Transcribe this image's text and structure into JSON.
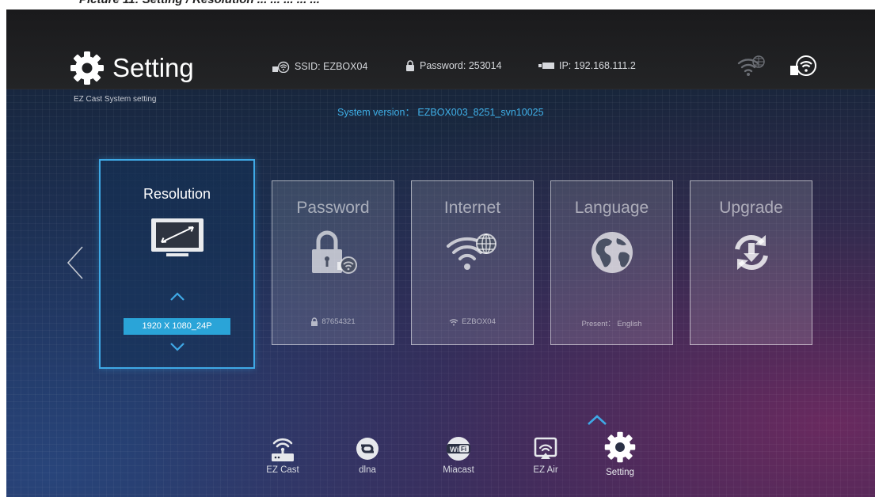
{
  "caption": "Picture 11: Setting / Resolution ... ... ... ... ...",
  "header": {
    "title": "Setting",
    "subtitle": "EZ Cast System setting",
    "ssid": "SSID: EZBOX04",
    "password": "Password: 253014",
    "ip": "IP: 192.168.111.2",
    "system_version": "System version： EZBOX003_8251_svn10025"
  },
  "cards": {
    "resolution": {
      "label": "Resolution",
      "value": "1920 X 1080_24P"
    },
    "password": {
      "label": "Password",
      "footer": "87654321"
    },
    "internet": {
      "label": "Internet",
      "footer": "EZBOX04"
    },
    "language": {
      "label": "Language",
      "footer": "Present： English"
    },
    "upgrade": {
      "label": "Upgrade"
    }
  },
  "bottom_nav": {
    "items": [
      {
        "label": "EZ Cast",
        "icon": "router-icon"
      },
      {
        "label": "dlna",
        "icon": "dlna-icon"
      },
      {
        "label": "Miacast",
        "icon": "wifi-badge-icon"
      },
      {
        "label": "EZ Air",
        "icon": "airplay-icon"
      },
      {
        "label": "Setting",
        "icon": "gear-icon"
      }
    ],
    "active": "Setting"
  },
  "colors": {
    "accent": "#3fa9e6",
    "value_bg": "#2aa4d8",
    "version_text": "#3fb0e8"
  }
}
